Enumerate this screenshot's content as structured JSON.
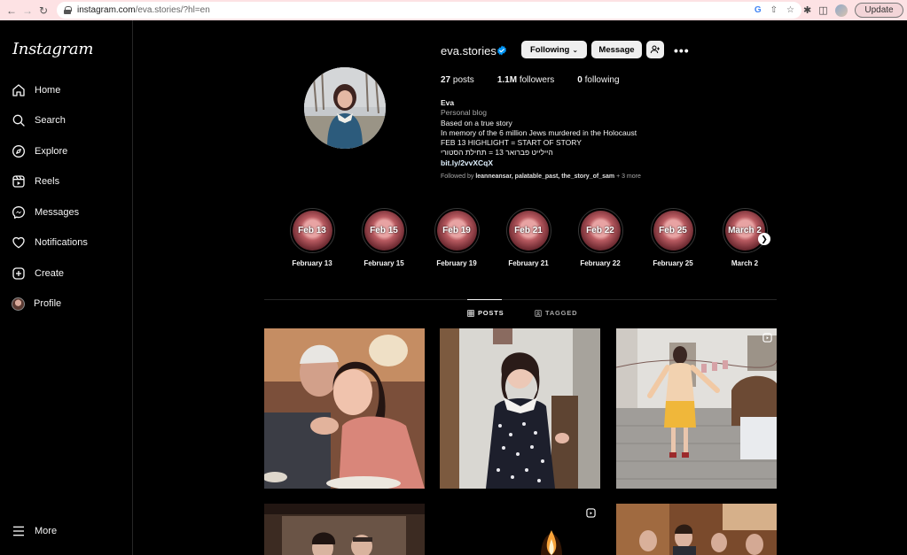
{
  "browser": {
    "url_host": "instagram.com",
    "url_path": "/eva.stories/?hl=en",
    "update_label": "Update"
  },
  "sidebar": {
    "logo": "Instagram",
    "items": [
      {
        "label": "Home",
        "icon": "home-icon"
      },
      {
        "label": "Search",
        "icon": "search-icon"
      },
      {
        "label": "Explore",
        "icon": "compass-icon"
      },
      {
        "label": "Reels",
        "icon": "reels-icon"
      },
      {
        "label": "Messages",
        "icon": "messenger-icon"
      },
      {
        "label": "Notifications",
        "icon": "heart-icon"
      },
      {
        "label": "Create",
        "icon": "plus-square-icon"
      },
      {
        "label": "Profile",
        "icon": "avatar"
      }
    ],
    "more_label": "More"
  },
  "profile": {
    "username": "eva.stories",
    "following_label": "Following",
    "message_label": "Message",
    "posts_count": "27",
    "posts_label": "posts",
    "followers_count": "1.1M",
    "followers_label": "followers",
    "following_count": "0",
    "following_text": "following",
    "name": "Eva",
    "category": "Personal blog",
    "bio_lines": [
      "Based on a true story",
      "In memory of the 6 million Jews murdered in the Holocaust",
      "FEB 13 HIGHLIGHT = START OF STORY",
      "היילייט פברואר 13 = תחילת הסטורי"
    ],
    "link": "bit.ly/2vvXCqX",
    "followed_by_prefix": "Followed by",
    "followed_by_names": "leanneansar, palatable_past, the_story_of_sam",
    "followed_by_more": "+ 3 more"
  },
  "highlights": [
    {
      "cover": "Feb 13",
      "label": "February 13"
    },
    {
      "cover": "Feb 15",
      "label": "February 15"
    },
    {
      "cover": "Feb 19",
      "label": "February 19"
    },
    {
      "cover": "Feb 21",
      "label": "February 21"
    },
    {
      "cover": "Feb 22",
      "label": "February 22"
    },
    {
      "cover": "Feb 25",
      "label": "February 25"
    },
    {
      "cover": "March 2",
      "label": "March 2"
    }
  ],
  "tabs": {
    "posts": "POSTS",
    "tagged": "TAGGED"
  },
  "colors": {
    "background": "#000000",
    "text": "#f5f5f5",
    "secondary_text": "#a8a8a8",
    "verified": "#0095f6",
    "button_bg": "#efefef"
  }
}
